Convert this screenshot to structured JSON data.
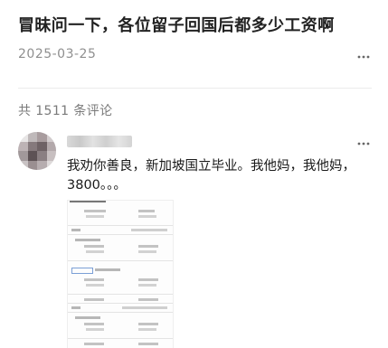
{
  "post": {
    "title": "冒昧问一下，各位留子回国后都多少工资啊",
    "date": "2025-03-25"
  },
  "comments_section": {
    "count_label": "共 1511 条评论"
  },
  "comment": {
    "text": "我劝你善良，新加坡国立毕业。我他妈，我他妈，3800。。。"
  },
  "icons": {
    "post_more": "more-horizontal-icon",
    "comment_more": "more-horizontal-icon"
  },
  "colors": {
    "title": "#222222",
    "meta": "#8f8f8f",
    "divider": "#ececec"
  }
}
